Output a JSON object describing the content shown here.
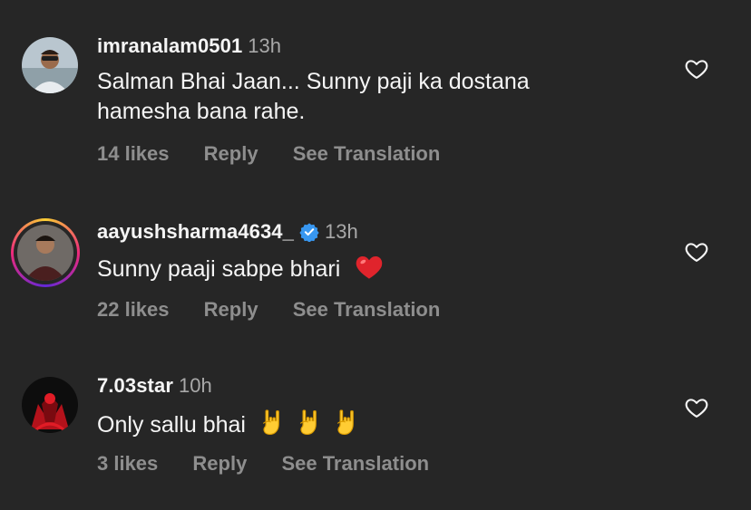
{
  "comments": [
    {
      "username": "imranalam0501",
      "time": "13h",
      "verified": false,
      "text_line1": "Salman Bhai Jaan... Sunny paji ka dostana",
      "text_line2": "hamesha bana rahe.",
      "likes": "14 likes",
      "reply": "Reply",
      "translate": "See Translation"
    },
    {
      "username": "aayushsharma4634_",
      "time": "13h",
      "verified": true,
      "text": "Sunny paaji sabpe bhari",
      "emoji": "red-heart",
      "likes": "22 likes",
      "reply": "Reply",
      "translate": "See Translation"
    },
    {
      "username": "7.03star",
      "time": "10h",
      "verified": false,
      "text": "Only sallu bhai",
      "emoji": "sign-of-horns x3",
      "likes": "3 likes",
      "reply": "Reply",
      "translate": "See Translation"
    }
  ],
  "colors": {
    "background": "#262626",
    "text": "#f5f5f5",
    "muted": "#8e8e8e",
    "time": "#a8a8a8",
    "verified": "#3897f0",
    "heart_emoji": "#e0242c"
  }
}
